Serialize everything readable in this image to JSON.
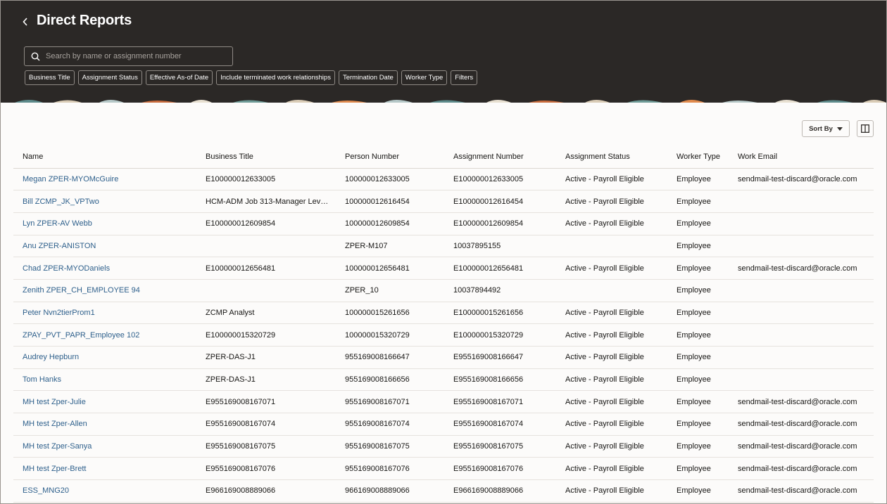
{
  "header": {
    "title": "Direct Reports",
    "search_placeholder": "Search by name or assignment number",
    "filters": [
      "Business Title",
      "Assignment Status",
      "Effective As-of Date",
      "Include terminated work relationships",
      "Termination Date",
      "Worker Type",
      "Filters"
    ]
  },
  "toolbar": {
    "sort_label": "Sort By"
  },
  "table": {
    "columns": [
      "Name",
      "Business Title",
      "Person Number",
      "Assignment Number",
      "Assignment Status",
      "Worker Type",
      "Work Email"
    ],
    "rows": [
      [
        "Megan ZPER-MYOMcGuire",
        "E100000012633005",
        "100000012633005",
        "E100000012633005",
        "Active - Payroll Eligible",
        "Employee",
        "sendmail-test-discard@oracle.com"
      ],
      [
        "Bill ZCMP_JK_VPTwo",
        "HCM-ADM Job 313-Manager Lev…",
        "100000012616454",
        "E100000012616454",
        "Active - Payroll Eligible",
        "Employee",
        ""
      ],
      [
        "Lyn ZPER-AV Webb",
        "E100000012609854",
        "100000012609854",
        "E100000012609854",
        "Active - Payroll Eligible",
        "Employee",
        ""
      ],
      [
        "Anu ZPER-ANISTON",
        "",
        "ZPER-M107",
        "10037895155",
        "",
        "Employee",
        ""
      ],
      [
        "Chad ZPER-MYODaniels",
        "E100000012656481",
        "100000012656481",
        "E100000012656481",
        "Active - Payroll Eligible",
        "Employee",
        "sendmail-test-discard@oracle.com"
      ],
      [
        "Zenith ZPER_CH_EMPLOYEE 94",
        "",
        "ZPER_10",
        "10037894492",
        "",
        "Employee",
        ""
      ],
      [
        "Peter Nvn2tierProm1",
        "ZCMP Analyst",
        "100000015261656",
        "E100000015261656",
        "Active - Payroll Eligible",
        "Employee",
        ""
      ],
      [
        "ZPAY_PVT_PAPR_Employee 102",
        "E100000015320729",
        "100000015320729",
        "E100000015320729",
        "Active - Payroll Eligible",
        "Employee",
        ""
      ],
      [
        "Audrey Hepburn",
        "ZPER-DAS-J1",
        "955169008166647",
        "E955169008166647",
        "Active - Payroll Eligible",
        "Employee",
        ""
      ],
      [
        "Tom Hanks",
        "ZPER-DAS-J1",
        "955169008166656",
        "E955169008166656",
        "Active - Payroll Eligible",
        "Employee",
        ""
      ],
      [
        "MH test Zper-Julie",
        "E955169008167071",
        "955169008167071",
        "E955169008167071",
        "Active - Payroll Eligible",
        "Employee",
        "sendmail-test-discard@oracle.com"
      ],
      [
        "MH test Zper-Allen",
        "E955169008167074",
        "955169008167074",
        "E955169008167074",
        "Active - Payroll Eligible",
        "Employee",
        "sendmail-test-discard@oracle.com"
      ],
      [
        "MH test Zper-Sanya",
        "E955169008167075",
        "955169008167075",
        "E955169008167075",
        "Active - Payroll Eligible",
        "Employee",
        "sendmail-test-discard@oracle.com"
      ],
      [
        "MH test Zper-Brett",
        "E955169008167076",
        "955169008167076",
        "E955169008167076",
        "Active - Payroll Eligible",
        "Employee",
        "sendmail-test-discard@oracle.com"
      ],
      [
        "ESS_MNG20",
        "E966169008889066",
        "966169008889066",
        "E966169008889066",
        "Active - Payroll Eligible",
        "Employee",
        "sendmail-test-discard@oracle.com"
      ]
    ]
  },
  "icons": {
    "back": "chevron-left-icon",
    "search": "search-icon",
    "sort": "caret-down-icon",
    "columns": "columns-icon"
  },
  "colors": {
    "header_bg": "#2b2826",
    "link": "#2d5f8b",
    "page_bg": "#fcfbfa"
  }
}
